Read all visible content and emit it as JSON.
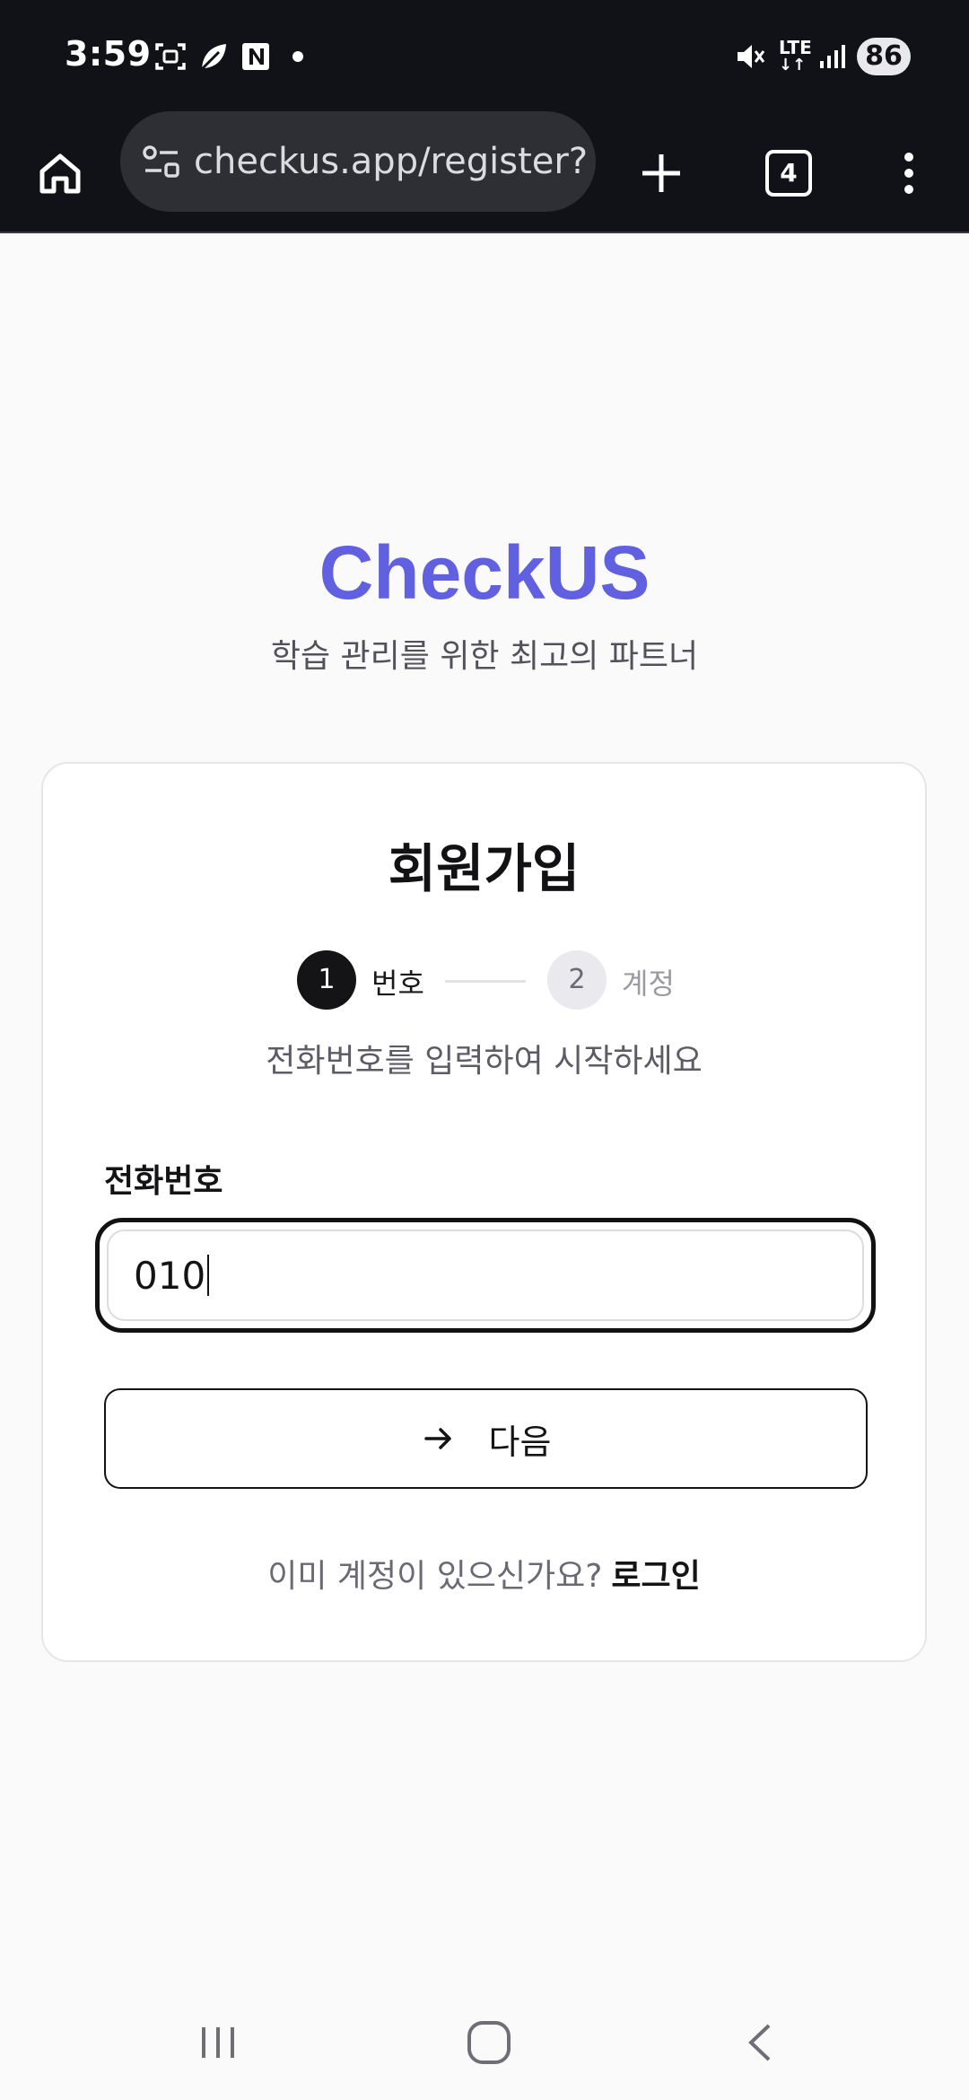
{
  "status_bar": {
    "time": "3:59",
    "battery": "86",
    "network": "LTE",
    "icons": [
      "screenshot-icon",
      "leaf-icon",
      "n-app-icon",
      "dot-icon",
      "mute-icon",
      "lte-icon",
      "signal-icon",
      "battery-icon"
    ]
  },
  "browser": {
    "url": "checkus.app/register?",
    "tab_count": "4",
    "icons": [
      "home-icon",
      "site-settings-icon",
      "new-tab-icon",
      "tabs-icon",
      "menu-icon"
    ]
  },
  "page": {
    "brand": "CheckUS",
    "tagline": "학습 관리를 위한 최고의 파트너",
    "brand_color": "#6060e0"
  },
  "card": {
    "title": "회원가입",
    "steps": [
      {
        "number": "1",
        "label": "번호",
        "active": true
      },
      {
        "number": "2",
        "label": "계정",
        "active": false
      }
    ],
    "instruction": "전화번호를 입력하여 시작하세요",
    "phone_label": "전화번호",
    "phone_value": "010",
    "next_button": "다음",
    "login_question": "이미 계정이 있으신가요?",
    "login_link": "로그인"
  },
  "nav_bar": {
    "icons": [
      "recent-apps-icon",
      "home-nav-icon",
      "back-icon"
    ]
  }
}
